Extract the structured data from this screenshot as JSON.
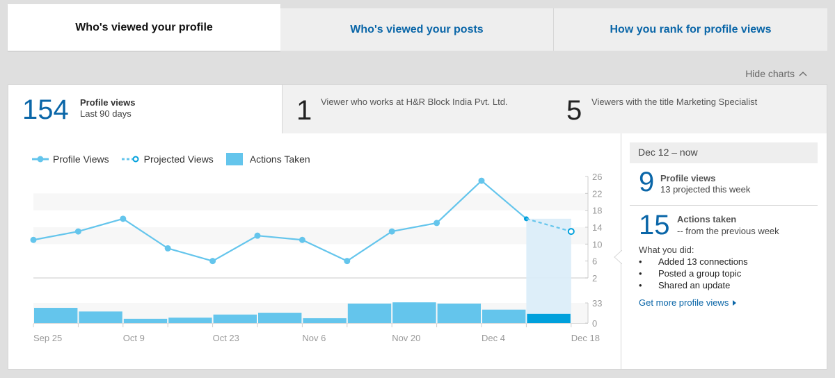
{
  "tabs": [
    {
      "label": "Who's viewed your profile",
      "active": true
    },
    {
      "label": "Who's viewed your posts",
      "active": false
    },
    {
      "label": "How you rank for profile views",
      "active": false
    }
  ],
  "hide_charts": {
    "label": "Hide charts",
    "icon": "chevron-up-icon"
  },
  "stats": {
    "profile_views": {
      "value": "154",
      "label": "Profile views",
      "sub": "Last 90 days"
    },
    "company": {
      "value": "1",
      "text": "Viewer who works at H&R Block India Pvt. Ltd."
    },
    "title": {
      "value": "5",
      "text": "Viewers with the title Marketing Specialist"
    }
  },
  "legend": {
    "profile_views": "Profile Views",
    "projected_views": "Projected Views",
    "actions_taken": "Actions Taken"
  },
  "colors": {
    "line": "#64c5ec",
    "bar": "#64c5ec",
    "bar_current": "#00a0dc",
    "highlight": "#d9ecf8",
    "accent": "#0a66a8"
  },
  "chart_data": {
    "type": "line+bar",
    "x_tick_labels": [
      "Sep 25",
      "Oct 9",
      "Oct 23",
      "Nov 6",
      "Nov 20",
      "Dec 4",
      "Dec 18"
    ],
    "series": [
      {
        "name": "Profile Views",
        "type": "line",
        "values": [
          11,
          13,
          16,
          9,
          6,
          12,
          11,
          6,
          13,
          15,
          25,
          16
        ]
      },
      {
        "name": "Projected Views",
        "type": "line-dashed",
        "values": [
          16,
          13
        ]
      },
      {
        "name": "Actions Taken",
        "type": "bar",
        "values": [
          25,
          19,
          7,
          9,
          14,
          17,
          8,
          32,
          34,
          32,
          22,
          15
        ]
      }
    ],
    "line_yaxis": {
      "ticks": [
        26,
        22,
        18,
        14,
        10,
        6,
        2
      ],
      "range": [
        2,
        26
      ]
    },
    "bar_yaxis": {
      "ticks": [
        33,
        0
      ],
      "range": [
        0,
        33
      ]
    },
    "highlighted_week_index": 11,
    "grid": "alternating bands"
  },
  "side": {
    "range": "Dec 12 – now",
    "profile_views": {
      "value": "9",
      "label": "Profile views",
      "sub": "13 projected this week"
    },
    "actions": {
      "value": "15",
      "label": "Actions taken",
      "sub": "-- from the previous week"
    },
    "what_you_did_label": "What you did:",
    "what_you_did": [
      "Added 13 connections",
      "Posted a group topic",
      "Shared an update"
    ],
    "more_link": "Get more profile views"
  }
}
